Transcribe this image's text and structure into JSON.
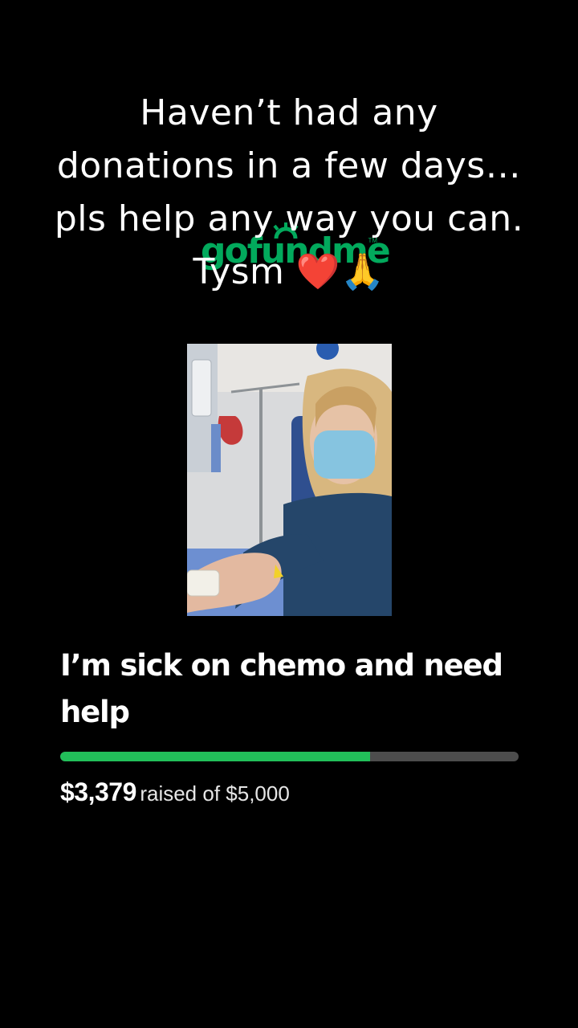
{
  "caption": {
    "lines": [
      "Haven’t had any",
      "donations in a few days…",
      "pls help any way you can.",
      "Tysm ❤️🙏"
    ]
  },
  "logo": {
    "text": "gofundme",
    "tm": "TM",
    "color": "#02a95c"
  },
  "campaign": {
    "title": "I’m sick on chemo and need help",
    "raised": "$3,379",
    "goal_text": "raised of $5,000",
    "progress_fraction": 0.6758,
    "progress_color": "#22bf5a",
    "track_color": "#4d4d4d"
  }
}
